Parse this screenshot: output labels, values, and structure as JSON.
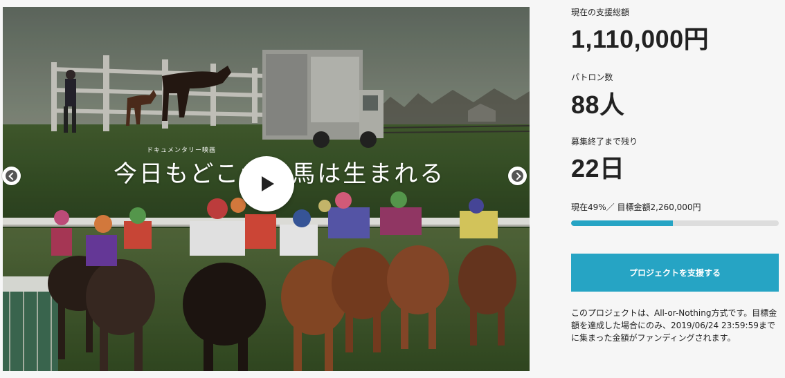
{
  "hero": {
    "subtitle": "ドキュメンタリー映画",
    "title": "今日もどこかで馬は生まれる",
    "controls": {
      "play": "play-icon",
      "prev": "chevron-left-icon",
      "next": "chevron-right-icon"
    }
  },
  "stats": {
    "total_label": "現在の支援総額",
    "total_value": "1,110,000円",
    "patrons_label": "パトロン数",
    "patrons_value": "88人",
    "remaining_label": "募集終了まで残り",
    "remaining_value": "22日",
    "progress_text": "現在49%／ 目標金額2,260,000円",
    "progress_percent": 49
  },
  "cta": {
    "support_label": "プロジェクトを支援する"
  },
  "note": {
    "text": "このプロジェクトは、All-or-Nothing方式です。目標金額を達成した場合にのみ、2019/06/24 23:59:59までに集まった金額がファンディングされます。"
  },
  "colors": {
    "accent": "#26a4c4",
    "track": "#dddddd",
    "background": "#f6f6f6",
    "text": "#222222"
  }
}
